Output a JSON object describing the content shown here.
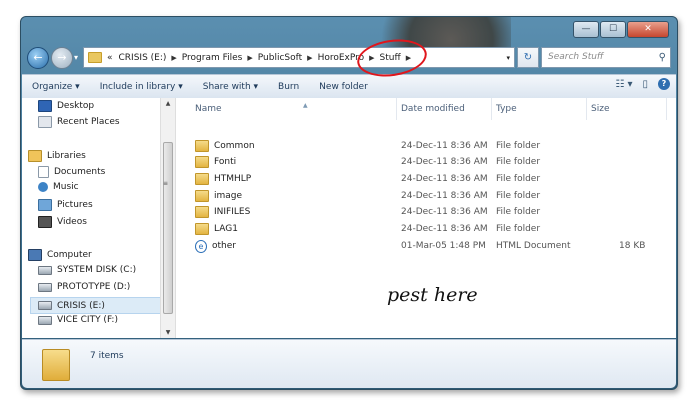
{
  "window": {
    "controls": {
      "minimize": "—",
      "maximize": "☐",
      "close": "✕"
    }
  },
  "nav": {
    "back_icon": "back-arrow-icon",
    "forward_icon": "forward-arrow-icon",
    "back_glyph": "←",
    "forward_glyph": "→",
    "history_glyph": "▾"
  },
  "address": {
    "overflow": "«",
    "crumbs": [
      "CRISIS (E:)",
      "Program Files",
      "PublicSoft",
      "HoroExPro",
      "Stuff"
    ],
    "separator": "▶",
    "dropdown": "▾",
    "refresh": "↻"
  },
  "search": {
    "placeholder": "Search Stuff",
    "icon_glyph": "⚲"
  },
  "toolbar": {
    "organize": "Organize ▾",
    "include": "Include in library ▾",
    "share": "Share with ▾",
    "burn": "Burn",
    "newfolder": "New folder",
    "views_glyph": "☷ ▾",
    "pane_glyph": "▯",
    "help_glyph": "?"
  },
  "sidebar": {
    "favorites": [
      {
        "label": "Desktop"
      },
      {
        "label": "Recent Places"
      }
    ],
    "libraries": {
      "label": "Libraries",
      "items": [
        {
          "label": "Documents"
        },
        {
          "label": "Music"
        },
        {
          "label": "Pictures"
        },
        {
          "label": "Videos"
        }
      ]
    },
    "computer": {
      "label": "Computer",
      "drives": [
        {
          "label": "SYSTEM DISK (C:)"
        },
        {
          "label": "PROTOTYPE  (D:)"
        },
        {
          "label": "CRISIS  (E:)"
        },
        {
          "label": "VICE CITY  (F:)"
        }
      ]
    },
    "scroll_up": "▲",
    "scroll_down": "▼",
    "grip": "≡"
  },
  "columns": {
    "name": "Name",
    "date": "Date modified",
    "type": "Type",
    "size": "Size",
    "sort_glyph": "▲"
  },
  "files": [
    {
      "name": "Common",
      "date": "24-Dec-11 8:36 AM",
      "type": "File folder",
      "size": ""
    },
    {
      "name": "Fonti",
      "date": "24-Dec-11 8:36 AM",
      "type": "File folder",
      "size": ""
    },
    {
      "name": "HTMHLP",
      "date": "24-Dec-11 8:36 AM",
      "type": "File folder",
      "size": ""
    },
    {
      "name": "image",
      "date": "24-Dec-11 8:36 AM",
      "type": "File folder",
      "size": ""
    },
    {
      "name": "INIFILES",
      "date": "24-Dec-11 8:36 AM",
      "type": "File folder",
      "size": ""
    },
    {
      "name": "LAG1",
      "date": "24-Dec-11 8:36 AM",
      "type": "File folder",
      "size": ""
    },
    {
      "name": "other",
      "date": "01-Mar-05 1:48 PM",
      "type": "HTML Document",
      "size": "18 KB"
    }
  ],
  "html_icon_glyph": "e",
  "annotation": {
    "text": "pest here"
  },
  "details": {
    "count": "7 items"
  }
}
